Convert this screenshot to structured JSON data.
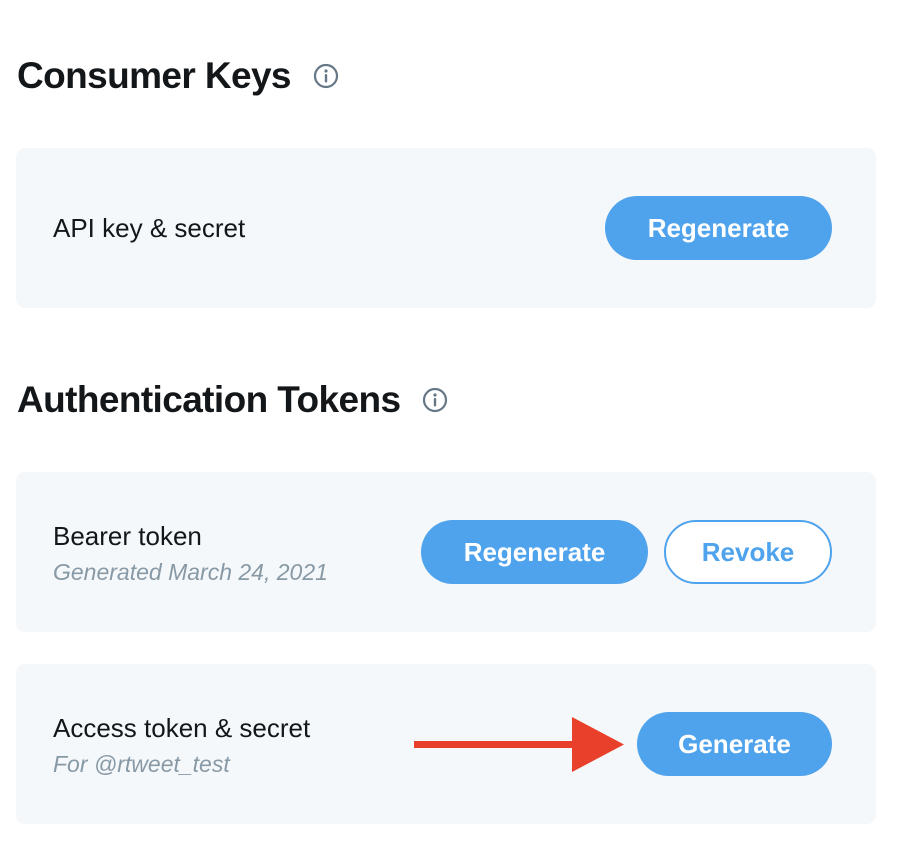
{
  "consumer_keys": {
    "title": "Consumer Keys",
    "info_icon": "info-icon",
    "api_key": {
      "label": "API key & secret",
      "regenerate_label": "Regenerate"
    }
  },
  "auth_tokens": {
    "title": "Authentication Tokens",
    "info_icon": "info-icon",
    "bearer": {
      "label": "Bearer token",
      "subtext": "Generated March 24, 2021",
      "regenerate_label": "Regenerate",
      "revoke_label": "Revoke"
    },
    "access": {
      "label": "Access token & secret",
      "subtext": "For @rtweet_test",
      "generate_label": "Generate"
    }
  },
  "annotation": {
    "arrow_icon": "arrow-right-icon",
    "arrow_color": "#e8402a"
  },
  "colors": {
    "accent": "#4fa3ec",
    "card_background": "#f5f8fa",
    "muted_text": "#8899a6",
    "heading_text": "#14171a"
  }
}
